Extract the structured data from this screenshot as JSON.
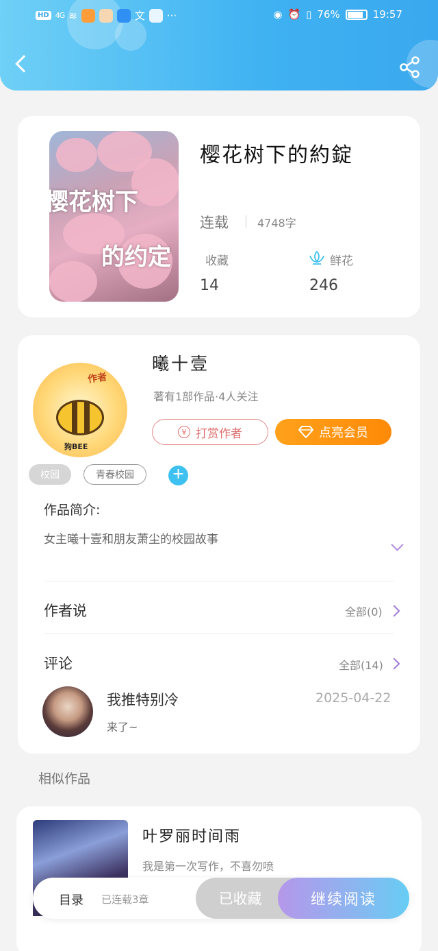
{
  "status_bar": {
    "network_badge": "HD",
    "signal_text": "4G",
    "battery_percent": "76%",
    "time": "19:57"
  },
  "book": {
    "title": "樱花树下的約錠",
    "cover_text_line1": "樱花树下",
    "cover_text_line2": "的约定",
    "status": "连载",
    "word_count": "4748字",
    "favorites_label": "收藏",
    "favorites_value": "14",
    "flowers_label": "鲜花",
    "flowers_value": "246"
  },
  "author": {
    "avatar_tag": "作者",
    "avatar_name": "狗BEE",
    "name": "曦十壹",
    "info": "著有1部作品·4人关注",
    "tip_label": "打赏作者",
    "vip_label": "点亮会员",
    "tags": [
      "校园",
      "青春校园"
    ],
    "add_tag_symbol": "+"
  },
  "intro": {
    "label": "作品简介:",
    "text": "女主曦十壹和朋友萧尘的校园故事"
  },
  "author_says": {
    "label": "作者说",
    "more": "全部(0)"
  },
  "comments": {
    "label": "评论",
    "more": "全部(14)",
    "items": [
      {
        "user": "我推特别冷",
        "date": "2025-04-22",
        "text": "来了~"
      }
    ]
  },
  "similar": {
    "heading": "相似作品",
    "items": [
      {
        "title": "叶罗丽时间雨",
        "desc": "我是第一次写作，不喜勿喷"
      }
    ]
  },
  "bottom_bar": {
    "toc_label": "目录",
    "toc_count": "已连载3章",
    "favorite_label": "已收藏",
    "read_label": "继续阅读"
  },
  "colors": {
    "header_blue": "#3fb2f2",
    "vip_orange": "#ff8a07",
    "tip_red": "#e06d6d",
    "accent_purple": "#b48be0"
  }
}
